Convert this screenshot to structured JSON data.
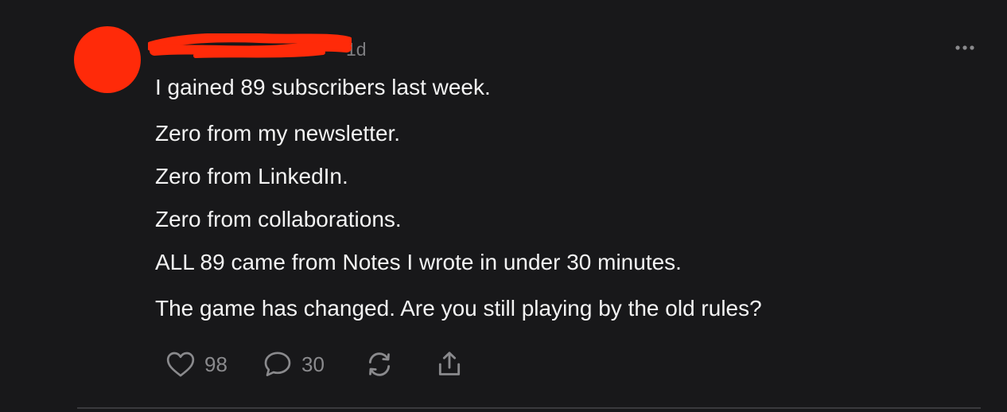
{
  "post": {
    "timestamp": "1d",
    "paragraphs": [
      "I gained 89 subscribers last week.",
      "Zero from my newsletter.",
      "Zero from LinkedIn.",
      "Zero from collaborations.",
      "ALL 89 came from Notes I wrote in under 30 minutes.",
      "The game has changed. Are you still playing by the old rules?"
    ]
  },
  "actions": {
    "likes": "98",
    "comments": "30"
  },
  "colors": {
    "background": "#18181a",
    "avatar": "#ff2a09",
    "redaction": "#ff2a09",
    "text": "#f3f3f3",
    "muted": "#8a8a8d"
  },
  "icons": {
    "like": "heart-icon",
    "comment": "speech-bubble-icon",
    "restack": "restack-arrows-icon",
    "share": "share-upload-icon",
    "more": "ellipsis-icon"
  }
}
